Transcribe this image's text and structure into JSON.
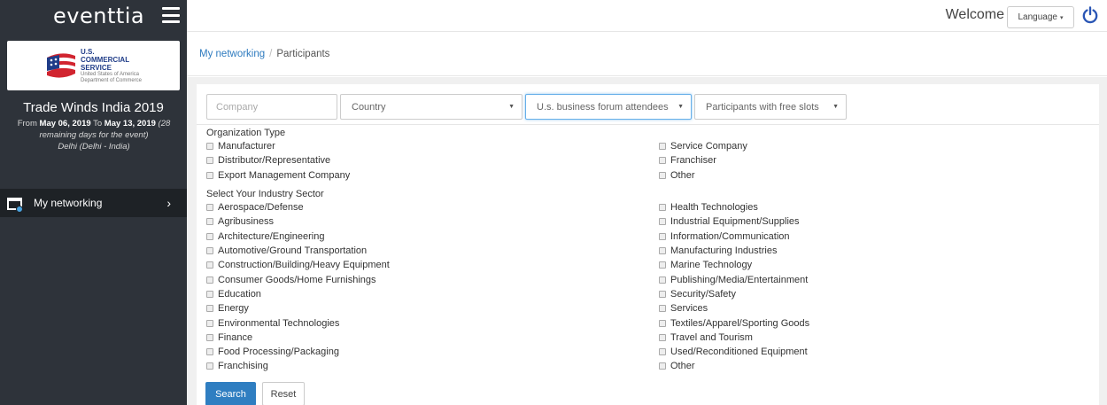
{
  "sidebar": {
    "brand": "eventtia",
    "logo": {
      "line1": "U.S.",
      "line2": "COMMERCIAL",
      "line3": "SERVICE",
      "sub1": "United States of America",
      "sub2": "Department of Commerce"
    },
    "event_title": "Trade Winds India 2019",
    "dates_prefix": "From",
    "date_start": "May 06, 2019",
    "dates_to": "To",
    "date_end": "May 13, 2019",
    "remaining": "(28 remaining days for the event)",
    "location": "Delhi (Delhi - India)",
    "nav_label": "My networking",
    "nav_chevron": "›"
  },
  "topbar": {
    "welcome": "Welcome",
    "language": "Language",
    "power_icon": "power-icon"
  },
  "breadcrumb": {
    "link": "My networking",
    "separator": "/",
    "current": "Participants"
  },
  "filters": {
    "company_placeholder": "Company",
    "country": "Country",
    "attendees": "U.s. business forum attendees",
    "slots": "Participants with free slots"
  },
  "org_type": {
    "title": "Organization Type",
    "left": [
      "Manufacturer",
      "Distributor/Representative",
      "Export Management Company"
    ],
    "right": [
      "Service Company",
      "Franchiser",
      "Other"
    ]
  },
  "industry": {
    "title": "Select Your Industry Sector",
    "left": [
      "Aerospace/Defense",
      "Agribusiness",
      "Architecture/Engineering",
      "Automotive/Ground Transportation",
      "Construction/Building/Heavy Equipment",
      "Consumer Goods/Home Furnishings",
      "Education",
      "Energy",
      "Environmental Technologies",
      "Finance",
      "Food Processing/Packaging",
      "Franchising"
    ],
    "right": [
      "Health Technologies",
      "Industrial Equipment/Supplies",
      "Information/Communication",
      "Manufacturing Industries",
      "Marine Technology",
      "Publishing/Media/Entertainment",
      "Security/Safety",
      "Services",
      "Textiles/Apparel/Sporting Goods",
      "Travel and Tourism",
      "Used/Reconditioned Equipment",
      "Other"
    ]
  },
  "buttons": {
    "search": "Search",
    "reset": "Reset"
  },
  "colors": {
    "sidebar": "#2e333a",
    "accent": "#2f7ec1",
    "power": "#2a56b5"
  }
}
